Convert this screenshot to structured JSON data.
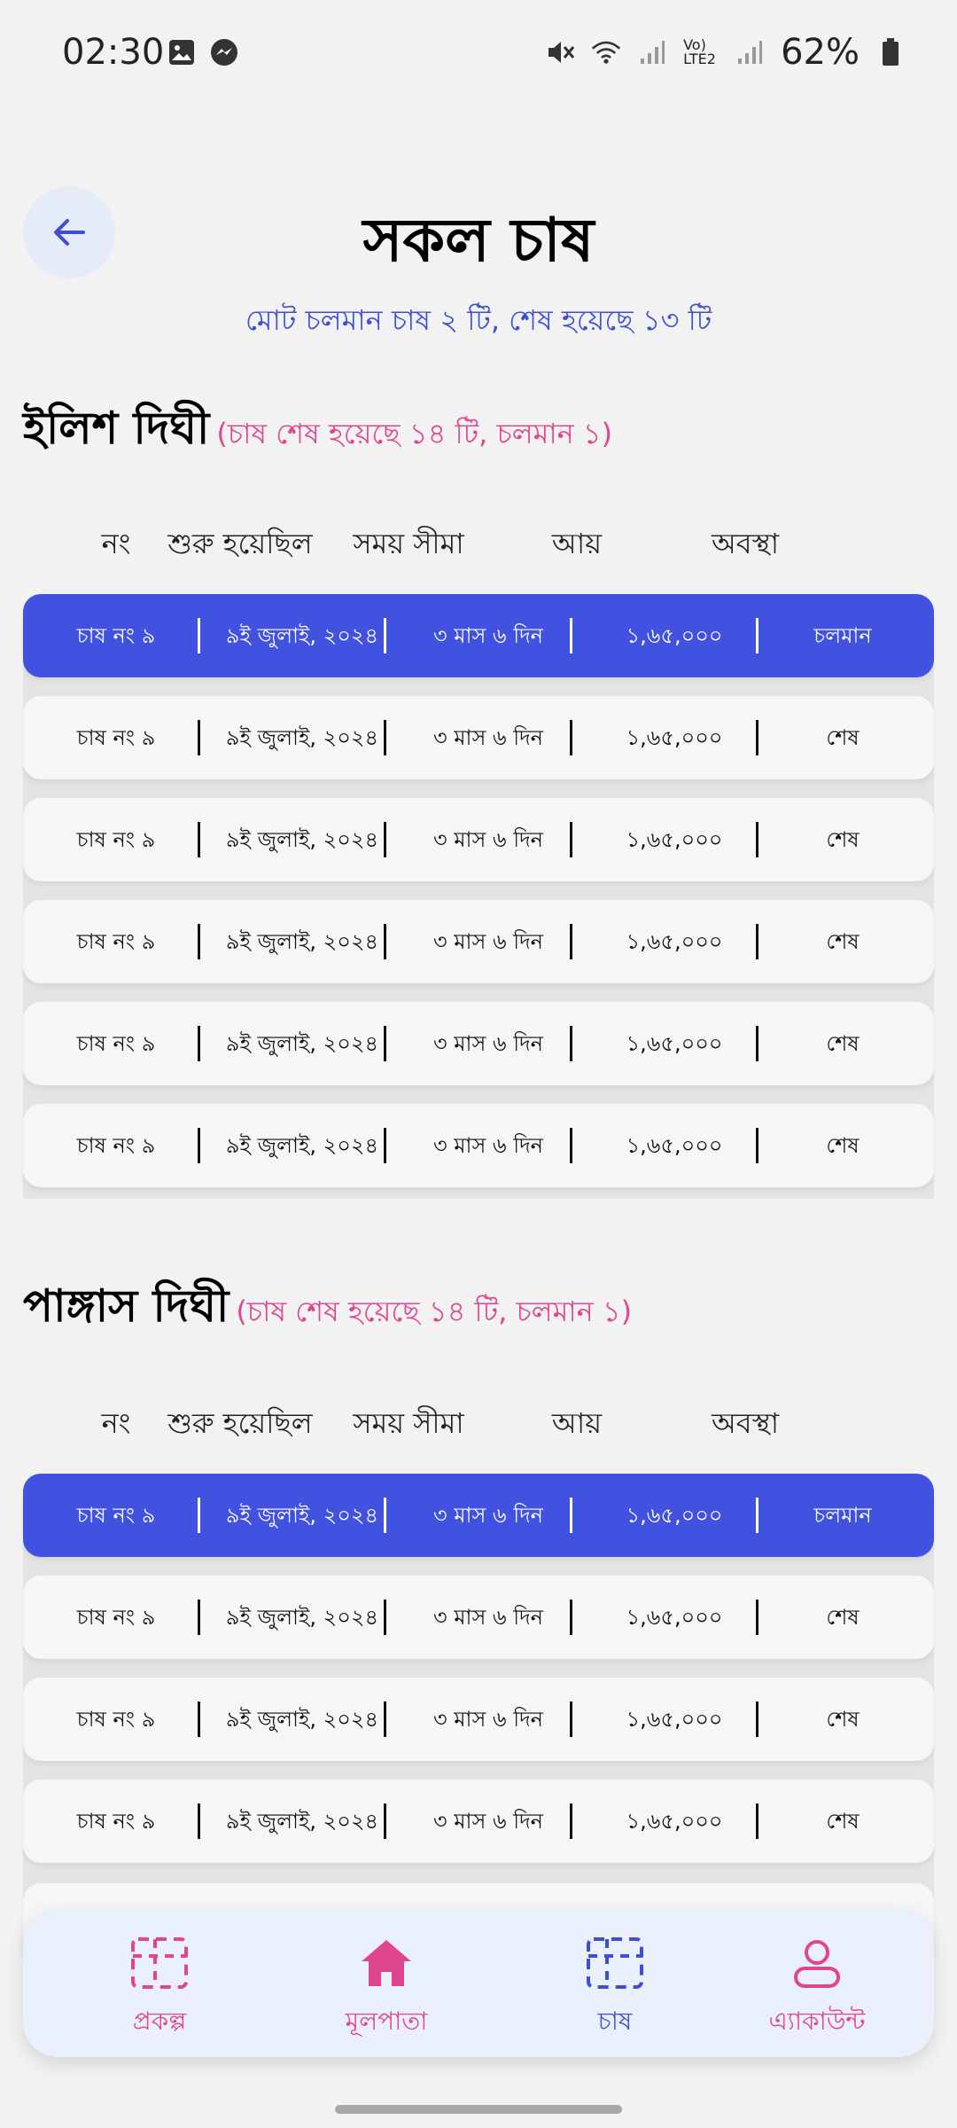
{
  "status_bar": {
    "time": "02:30",
    "battery": "62%",
    "network_label": "Vo) LTE2"
  },
  "header": {
    "title": "সকল চাষ",
    "summary": "মোট চলমান চাষ ২ টি, শেষ হয়েছে ১৩ টি"
  },
  "columns": [
    "নং",
    "শুরু হয়েছিল",
    "সময় সীমা",
    "আয়",
    "অবস্থা"
  ],
  "sections": [
    {
      "title": "ইলিশ দিঘী",
      "subtitle": "(চাষ শেষ হয়েছে ১৪ টি, চলমান ১)",
      "rows": [
        [
          "চাষ নং ৯",
          "৯ই জুলাই, ২০২৪",
          "৩ মাস ৬ দিন",
          "১,৬৫,০০০",
          "চলমান"
        ],
        [
          "চাষ নং ৯",
          "৯ই জুলাই, ২০২৪",
          "৩ মাস ৬ দিন",
          "১,৬৫,০০০",
          "শেষ"
        ],
        [
          "চাষ নং ৯",
          "৯ই জুলাই, ২০২৪",
          "৩ মাস ৬ দিন",
          "১,৬৫,০০০",
          "শেষ"
        ],
        [
          "চাষ নং ৯",
          "৯ই জুলাই, ২০২৪",
          "৩ মাস ৬ দিন",
          "১,৬৫,০০০",
          "শেষ"
        ],
        [
          "চাষ নং ৯",
          "৯ই জুলাই, ২০২৪",
          "৩ মাস ৬ দিন",
          "১,৬৫,০০০",
          "শেষ"
        ],
        [
          "চাষ নং ৯",
          "৯ই জুলাই, ২০২৪",
          "৩ মাস ৬ দিন",
          "১,৬৫,০০০",
          "শেষ"
        ]
      ]
    },
    {
      "title": "পাঙ্গাস দিঘী",
      "subtitle": "(চাষ শেষ হয়েছে ১৪ টি, চলমান ১)",
      "rows": [
        [
          "চাষ নং ৯",
          "৯ই জুলাই, ২০২৪",
          "৩ মাস ৬ দিন",
          "১,৬৫,০০০",
          "চলমান"
        ],
        [
          "চাষ নং ৯",
          "৯ই জুলাই, ২০২৪",
          "৩ মাস ৬ দিন",
          "১,৬৫,০০০",
          "শেষ"
        ],
        [
          "চাষ নং ৯",
          "৯ই জুলাই, ২০২৪",
          "৩ মাস ৬ দিন",
          "১,৬৫,০০০",
          "শেষ"
        ],
        [
          "চাষ নং ৯",
          "৯ই জুলাই, ২০২৪",
          "৩ মাস ৬ দিন",
          "১,৬৫,০০০",
          "শেষ"
        ]
      ]
    }
  ],
  "bottom_nav": [
    {
      "label": "প্রকল্প",
      "icon": "project-icon",
      "color": "#e0458f"
    },
    {
      "label": "মূলপাতা",
      "icon": "home-icon",
      "color": "#e0458f"
    },
    {
      "label": "চাষ",
      "icon": "farming-icon",
      "color": "#3f4fcf",
      "active": true
    },
    {
      "label": "এ্যাকাউন্ট",
      "icon": "account-icon",
      "color": "#e0458f"
    }
  ],
  "colors": {
    "accent": "#4152e0",
    "pink": "#e0458f",
    "summary_blue": "#3f4fcf"
  }
}
